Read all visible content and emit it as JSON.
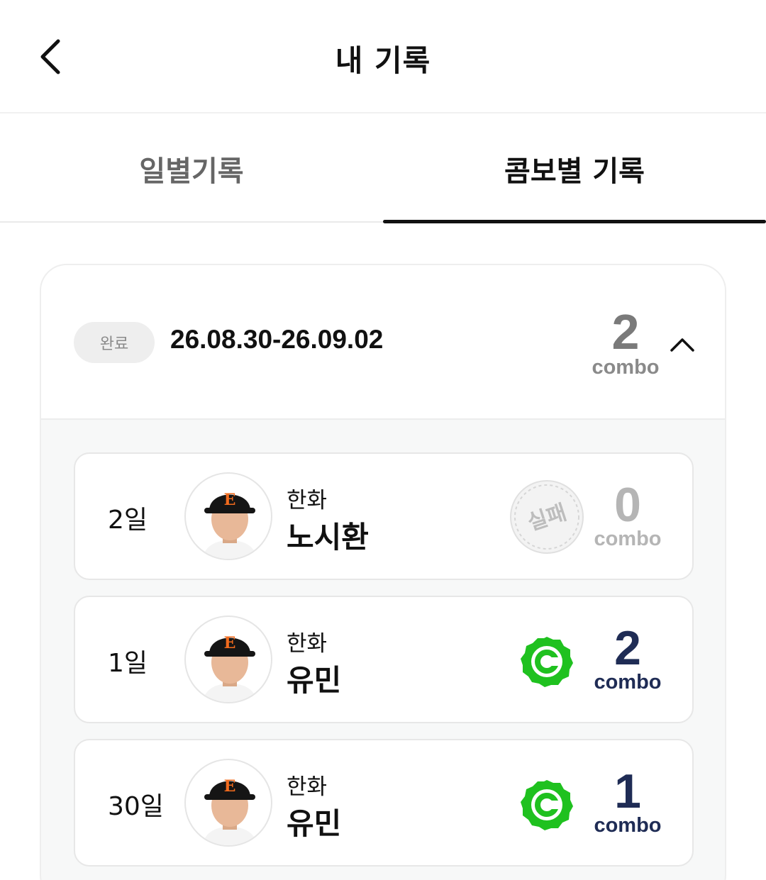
{
  "header": {
    "title": "내 기록",
    "back_icon": "chevron-left-icon"
  },
  "tabs": [
    {
      "label": "일별기록",
      "active": false
    },
    {
      "label": "콤보별 기록",
      "active": true
    }
  ],
  "colors": {
    "success": "#1fc11f",
    "combo_text": "#1f2c55",
    "muted": "#b5b5b5"
  },
  "combo_card": {
    "status": "완료",
    "date_range": "26.08.30-26.09.02",
    "combo_count": "2",
    "combo_label": "combo",
    "toggle_icon": "chevron-up-icon",
    "rows": [
      {
        "day": "2일",
        "team": "한화",
        "player": "노시환",
        "result": "실패",
        "result_icon": "fail-stamp-icon",
        "combo": "0",
        "combo_label": "combo"
      },
      {
        "day": "1일",
        "team": "한화",
        "player": "유민",
        "result_icon": "combo-success-icon",
        "combo": "2",
        "combo_label": "combo"
      },
      {
        "day": "30일",
        "team": "한화",
        "player": "유민",
        "result_icon": "combo-success-icon",
        "combo": "1",
        "combo_label": "combo"
      }
    ]
  }
}
